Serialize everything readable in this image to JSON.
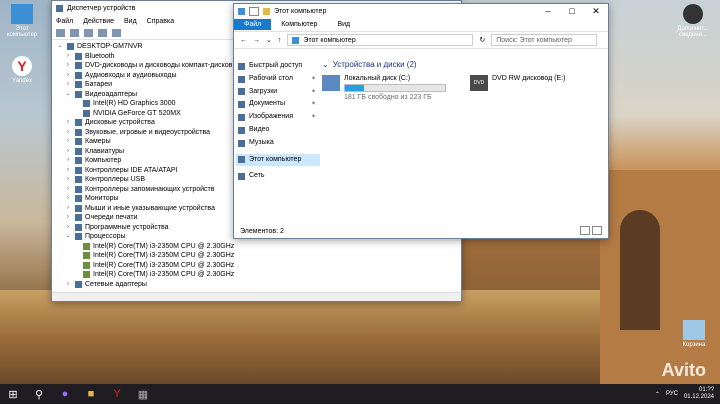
{
  "desktop": {
    "icons": [
      {
        "label": "Этот компьютер"
      },
      {
        "label": "Yandex"
      },
      {
        "label": "Дополнит... сведени..."
      },
      {
        "label": "Корзина"
      }
    ],
    "watermark": "Avito"
  },
  "device_manager": {
    "title": "Диспетчер устройств",
    "menu": [
      "Файл",
      "Действие",
      "Вид",
      "Справка"
    ],
    "tree": [
      {
        "label": "DESKTOP-GM7NVR",
        "level": 0,
        "expanded": true
      },
      {
        "label": "Bluetooth",
        "level": 1
      },
      {
        "label": "DVD-дисководы и дисководы компакт-дисков",
        "level": 1
      },
      {
        "label": "Аудиовходы и аудиовыходы",
        "level": 1
      },
      {
        "label": "Батареи",
        "level": 1
      },
      {
        "label": "Видеоадаптеры",
        "level": 1,
        "expanded": true
      },
      {
        "label": "Intel(R) HD Graphics 3000",
        "level": 2
      },
      {
        "label": "NVIDIA GeForce GT 520MX",
        "level": 2
      },
      {
        "label": "Дисковые устройства",
        "level": 1
      },
      {
        "label": "Звуковые, игровые и видеоустройства",
        "level": 1
      },
      {
        "label": "Камеры",
        "level": 1
      },
      {
        "label": "Клавиатуры",
        "level": 1
      },
      {
        "label": "Компьютер",
        "level": 1
      },
      {
        "label": "Контроллеры IDE ATA/ATAPI",
        "level": 1
      },
      {
        "label": "Контроллеры USB",
        "level": 1
      },
      {
        "label": "Контроллеры запоминающих устройств",
        "level": 1
      },
      {
        "label": "Мониторы",
        "level": 1
      },
      {
        "label": "Мыши и иные указывающие устройства",
        "level": 1
      },
      {
        "label": "Очереди печати",
        "level": 1
      },
      {
        "label": "Программные устройства",
        "level": 1
      },
      {
        "label": "Процессоры",
        "level": 1,
        "expanded": true
      },
      {
        "label": "Intel(R) Core(TM) i3-2350M CPU @ 2.30GHz",
        "level": 2
      },
      {
        "label": "Intel(R) Core(TM) i3-2350M CPU @ 2.30GHz",
        "level": 2
      },
      {
        "label": "Intel(R) Core(TM) i3-2350M CPU @ 2.30GHz",
        "level": 2
      },
      {
        "label": "Intel(R) Core(TM) i3-2350M CPU @ 2.30GHz",
        "level": 2
      },
      {
        "label": "Сетевые адаптеры",
        "level": 1
      }
    ]
  },
  "explorer": {
    "title": "Этот компьютер",
    "ribbon": [
      "Файл",
      "Компьютер",
      "Вид"
    ],
    "address": "Этот компьютер",
    "search_placeholder": "Поиск: Этот компьютер",
    "nav": [
      {
        "label": "Быстрый доступ",
        "pinned": false
      },
      {
        "label": "Рабочий стол",
        "pinned": true
      },
      {
        "label": "Загрузки",
        "pinned": true
      },
      {
        "label": "Документы",
        "pinned": true
      },
      {
        "label": "Изображения",
        "pinned": true
      },
      {
        "label": "Видео",
        "pinned": false
      },
      {
        "label": "Музыка",
        "pinned": false
      },
      {
        "label": "Этот компьютер",
        "pinned": false,
        "selected": true
      },
      {
        "label": "Сеть",
        "pinned": false
      }
    ],
    "group_title": "Устройства и диски (2)",
    "drives": [
      {
        "name": "Локальный диск (C:)",
        "free": "181 ГБ свободно из 223 ГБ",
        "used_fraction": 0.19
      },
      {
        "name": "DVD RW дисковод (E:)",
        "free": ""
      }
    ],
    "status": "Элементов: 2"
  },
  "taskbar": {
    "lang": "РУС",
    "time": "01:??",
    "date": "01.12.2024"
  }
}
